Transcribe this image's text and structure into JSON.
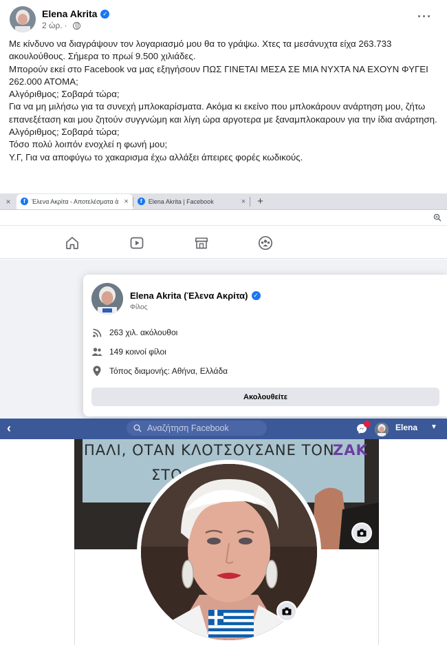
{
  "post": {
    "author": "Elena Akrita",
    "time": "2 ώρ.",
    "menu_label": "···",
    "paragraphs": [
      "Με κίνδυνο να διαγράψουν τον λογαριασμό μου θα το γράψω. Χτες τα μεσάνυχτα είχα 263.733 ακουλούθους. Σήμερα το πρωί 9.500 χιλιάδες.",
      "Μπορούν εκεί στο Facebook να μας εξηγήσουν ΠΩΣ ΓΙΝΕΤΑΙ ΜΕΣΑ ΣΕ ΜΙΑ ΝΥΧΤΑ ΝΑ ΕΧΟΥΝ ΦΥΓΕΙ 262.000 ΑΤΟΜΑ;",
      "Αλγόριθμος; Σοβαρά τώρα;",
      "Για να μη μιλήσω για τα συνεχή μπλοκαρίσματα. Ακόμα κι εκείνο που μπλοκάρουν ανάρτηση μου, ζήτω επανεξέταση και μου ζητούν συγγνώμη και λίγη ώρα αργοτερα με ξαναμπλοκαρουν για την ίδια ανάρτηση.",
      "Αλγόριθμος; Σοβαρά τώρα;",
      "Τόσο πολύ λοιπόν ενοχλεί η φωνή μου;",
      "Υ.Γ, Για να αποφύγω το χακαρισμα έχω αλλάξει άπειρες φορές κωδικούς."
    ]
  },
  "browser": {
    "tabs": [
      {
        "label": "Έλενα Ακρίτα - Αποτελέσματα ἀ",
        "active": true
      },
      {
        "label": "Elena Akrita | Facebook",
        "active": false
      }
    ],
    "lead_close": "×",
    "tab_close": "×",
    "new_tab": "+"
  },
  "nav": {
    "icons": [
      "home-icon",
      "watch-icon",
      "marketplace-icon",
      "groups-icon"
    ]
  },
  "hovercard": {
    "name": "Elena Akrita (Έλενα Ακρίτα)",
    "subtitle": "Φίλος",
    "followers": "263 χιλ. ακόλουθοι",
    "mutual_friends": "149 κοινοί φίλοι",
    "location": "Τόπος διαμονής: Αθήνα, Ελλάδα",
    "follow_button": "Ακολουθείτε"
  },
  "darkbar": {
    "back": "‹",
    "search_placeholder": "Αναζήτηση Facebook",
    "user_name": "Elena",
    "caret": "▼"
  },
  "cover": {
    "sign_line1": "ΠΑΛΙ, ΟΤΑΝ ΚΛΟΤΣΟΥΣΑΝΕ ΤΟΝ",
    "sign_colored": "ZAK",
    "sign_line2": "ΣΤΟ"
  },
  "colors": {
    "fb_blue": "#1877f2",
    "dark_header": "#3b5998",
    "text_secondary": "#65676b"
  }
}
